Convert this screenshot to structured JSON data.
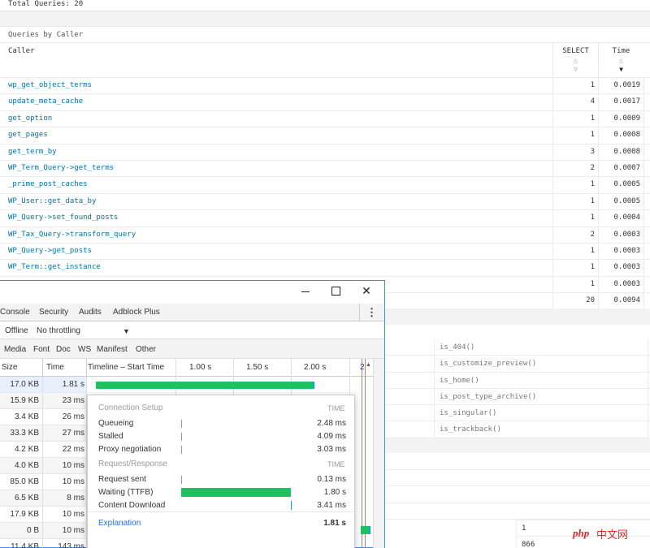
{
  "qm": {
    "total_queries": "Total Queries: 20",
    "caption": "Queries by Caller",
    "headers": {
      "caller": "Caller",
      "select": "SELECT",
      "time": "Time"
    },
    "rows": [
      {
        "caller": "wp_get_object_terms",
        "count": "1",
        "time": "0.0019"
      },
      {
        "caller": "update_meta_cache",
        "count": "4",
        "time": "0.0017"
      },
      {
        "caller": "get_option",
        "count": "1",
        "time": "0.0009"
      },
      {
        "caller": "get_pages",
        "count": "1",
        "time": "0.0008"
      },
      {
        "caller": "get_term_by",
        "count": "3",
        "time": "0.0008"
      },
      {
        "caller": "WP_Term_Query->get_terms",
        "count": "2",
        "time": "0.0007"
      },
      {
        "caller": "_prime_post_caches",
        "count": "1",
        "time": "0.0005"
      },
      {
        "caller": "WP_User::get_data_by",
        "count": "1",
        "time": "0.0005"
      },
      {
        "caller": "WP_Query->set_found_posts",
        "count": "1",
        "time": "0.0004"
      },
      {
        "caller": "WP_Tax_Query->transform_query",
        "count": "2",
        "time": "0.0003"
      },
      {
        "caller": "WP_Query->get_posts",
        "count": "1",
        "time": "0.0003"
      },
      {
        "caller": "WP_Term::get_instance",
        "count": "1",
        "time": "0.0003"
      },
      {
        "caller": "",
        "count": "1",
        "time": "0.0003"
      },
      {
        "caller": "",
        "count": "20",
        "time": "0.0094"
      }
    ],
    "conditionals": [
      "is_404()",
      "is_customize_preview()",
      "is_home()",
      "is_post_type_archive()",
      "is_singular()",
      "is_trackback()"
    ],
    "bottom_values": [
      "1",
      "866"
    ]
  },
  "devtools": {
    "tabs": [
      "Console",
      "Security",
      "Audits",
      "Adblock Plus"
    ],
    "more_icon": "⋮",
    "throttle": {
      "offline": "Offline",
      "throttling": "No throttling",
      "arrow": "▼"
    },
    "filters": [
      "Media",
      "Font",
      "Doc",
      "WS",
      "Manifest",
      "Other"
    ],
    "columns": {
      "size": "Size",
      "time": "Time",
      "timeline": "Timeline – Start Time"
    },
    "ticks": [
      "1.00 s",
      "1.50 s",
      "2.00 s",
      "2"
    ],
    "rows": [
      {
        "size": "17.0 KB",
        "time": "1.81 s"
      },
      {
        "size": "15.9 KB",
        "time": "23 ms"
      },
      {
        "size": "3.4 KB",
        "time": "26 ms"
      },
      {
        "size": "33.3 KB",
        "time": "27 ms"
      },
      {
        "size": "4.2 KB",
        "time": "22 ms"
      },
      {
        "size": "4.0 KB",
        "time": "10 ms"
      },
      {
        "size": "85.0 KB",
        "time": "10 ms"
      },
      {
        "size": "6.5 KB",
        "time": "8 ms"
      },
      {
        "size": "17.9 KB",
        "time": "10 ms"
      },
      {
        "size": "0 B",
        "time": "10 ms"
      },
      {
        "size": "11.4 KB",
        "time": "143 ms"
      }
    ],
    "timing": {
      "connection_setup": "Connection Setup",
      "request_response": "Request/Response",
      "time_label": "TIME",
      "queueing": {
        "label": "Queueing",
        "value": "2.48 ms"
      },
      "stalled": {
        "label": "Stalled",
        "value": "4.09 ms"
      },
      "proxy": {
        "label": "Proxy negotiation",
        "value": "3.03 ms"
      },
      "request_sent": {
        "label": "Request sent",
        "value": "0.13 ms"
      },
      "ttfb": {
        "label": "Waiting (TTFB)",
        "value": "1.80 s"
      },
      "download": {
        "label": "Content Download",
        "value": "3.41 ms"
      },
      "explanation": "Explanation",
      "total": "1.81 s"
    }
  },
  "watermark": {
    "php": "php",
    "cn": "中文网"
  },
  "colors": {
    "link": "#0073aa",
    "bar_green": "#1ec15f",
    "accent_blue": "#1a73e8"
  }
}
